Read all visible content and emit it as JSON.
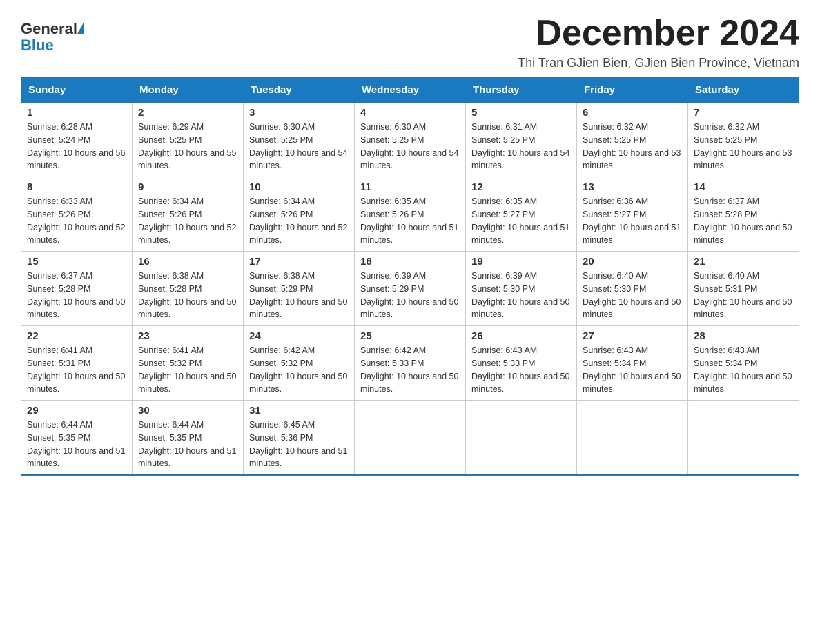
{
  "logo": {
    "general": "General",
    "blue": "Blue"
  },
  "header": {
    "month_title": "December 2024",
    "subtitle": "Thi Tran GJien Bien, GJien Bien Province, Vietnam"
  },
  "days_of_week": [
    "Sunday",
    "Monday",
    "Tuesday",
    "Wednesday",
    "Thursday",
    "Friday",
    "Saturday"
  ],
  "weeks": [
    [
      {
        "day": "1",
        "sunrise": "6:28 AM",
        "sunset": "5:24 PM",
        "daylight": "10 hours and 56 minutes."
      },
      {
        "day": "2",
        "sunrise": "6:29 AM",
        "sunset": "5:25 PM",
        "daylight": "10 hours and 55 minutes."
      },
      {
        "day": "3",
        "sunrise": "6:30 AM",
        "sunset": "5:25 PM",
        "daylight": "10 hours and 54 minutes."
      },
      {
        "day": "4",
        "sunrise": "6:30 AM",
        "sunset": "5:25 PM",
        "daylight": "10 hours and 54 minutes."
      },
      {
        "day": "5",
        "sunrise": "6:31 AM",
        "sunset": "5:25 PM",
        "daylight": "10 hours and 54 minutes."
      },
      {
        "day": "6",
        "sunrise": "6:32 AM",
        "sunset": "5:25 PM",
        "daylight": "10 hours and 53 minutes."
      },
      {
        "day": "7",
        "sunrise": "6:32 AM",
        "sunset": "5:25 PM",
        "daylight": "10 hours and 53 minutes."
      }
    ],
    [
      {
        "day": "8",
        "sunrise": "6:33 AM",
        "sunset": "5:26 PM",
        "daylight": "10 hours and 52 minutes."
      },
      {
        "day": "9",
        "sunrise": "6:34 AM",
        "sunset": "5:26 PM",
        "daylight": "10 hours and 52 minutes."
      },
      {
        "day": "10",
        "sunrise": "6:34 AM",
        "sunset": "5:26 PM",
        "daylight": "10 hours and 52 minutes."
      },
      {
        "day": "11",
        "sunrise": "6:35 AM",
        "sunset": "5:26 PM",
        "daylight": "10 hours and 51 minutes."
      },
      {
        "day": "12",
        "sunrise": "6:35 AM",
        "sunset": "5:27 PM",
        "daylight": "10 hours and 51 minutes."
      },
      {
        "day": "13",
        "sunrise": "6:36 AM",
        "sunset": "5:27 PM",
        "daylight": "10 hours and 51 minutes."
      },
      {
        "day": "14",
        "sunrise": "6:37 AM",
        "sunset": "5:28 PM",
        "daylight": "10 hours and 50 minutes."
      }
    ],
    [
      {
        "day": "15",
        "sunrise": "6:37 AM",
        "sunset": "5:28 PM",
        "daylight": "10 hours and 50 minutes."
      },
      {
        "day": "16",
        "sunrise": "6:38 AM",
        "sunset": "5:28 PM",
        "daylight": "10 hours and 50 minutes."
      },
      {
        "day": "17",
        "sunrise": "6:38 AM",
        "sunset": "5:29 PM",
        "daylight": "10 hours and 50 minutes."
      },
      {
        "day": "18",
        "sunrise": "6:39 AM",
        "sunset": "5:29 PM",
        "daylight": "10 hours and 50 minutes."
      },
      {
        "day": "19",
        "sunrise": "6:39 AM",
        "sunset": "5:30 PM",
        "daylight": "10 hours and 50 minutes."
      },
      {
        "day": "20",
        "sunrise": "6:40 AM",
        "sunset": "5:30 PM",
        "daylight": "10 hours and 50 minutes."
      },
      {
        "day": "21",
        "sunrise": "6:40 AM",
        "sunset": "5:31 PM",
        "daylight": "10 hours and 50 minutes."
      }
    ],
    [
      {
        "day": "22",
        "sunrise": "6:41 AM",
        "sunset": "5:31 PM",
        "daylight": "10 hours and 50 minutes."
      },
      {
        "day": "23",
        "sunrise": "6:41 AM",
        "sunset": "5:32 PM",
        "daylight": "10 hours and 50 minutes."
      },
      {
        "day": "24",
        "sunrise": "6:42 AM",
        "sunset": "5:32 PM",
        "daylight": "10 hours and 50 minutes."
      },
      {
        "day": "25",
        "sunrise": "6:42 AM",
        "sunset": "5:33 PM",
        "daylight": "10 hours and 50 minutes."
      },
      {
        "day": "26",
        "sunrise": "6:43 AM",
        "sunset": "5:33 PM",
        "daylight": "10 hours and 50 minutes."
      },
      {
        "day": "27",
        "sunrise": "6:43 AM",
        "sunset": "5:34 PM",
        "daylight": "10 hours and 50 minutes."
      },
      {
        "day": "28",
        "sunrise": "6:43 AM",
        "sunset": "5:34 PM",
        "daylight": "10 hours and 50 minutes."
      }
    ],
    [
      {
        "day": "29",
        "sunrise": "6:44 AM",
        "sunset": "5:35 PM",
        "daylight": "10 hours and 51 minutes."
      },
      {
        "day": "30",
        "sunrise": "6:44 AM",
        "sunset": "5:35 PM",
        "daylight": "10 hours and 51 minutes."
      },
      {
        "day": "31",
        "sunrise": "6:45 AM",
        "sunset": "5:36 PM",
        "daylight": "10 hours and 51 minutes."
      },
      null,
      null,
      null,
      null
    ]
  ],
  "labels": {
    "sunrise": "Sunrise:",
    "sunset": "Sunset:",
    "daylight": "Daylight:"
  }
}
